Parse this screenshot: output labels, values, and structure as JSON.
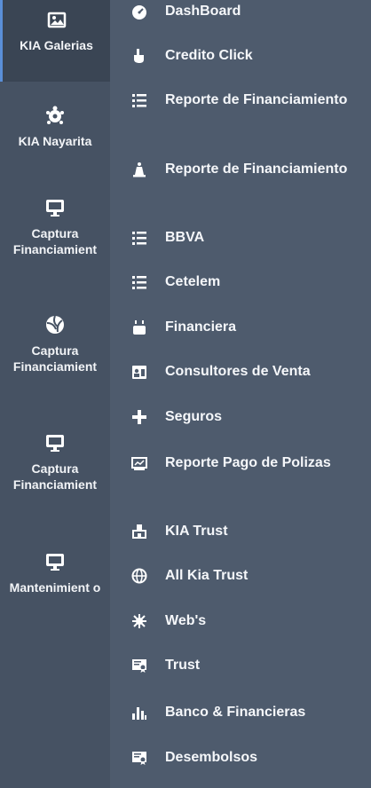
{
  "left_nav": [
    {
      "label": "KIA Galerias",
      "icon": "image-icon",
      "active": true
    },
    {
      "label": "KIA Nayarita",
      "icon": "turtle-icon",
      "active": false
    },
    {
      "label": "Captura Financiamient",
      "icon": "monitor-icon",
      "active": false
    },
    {
      "label": "Captura Financiamient",
      "icon": "volleyball-icon",
      "active": false
    },
    {
      "label": "Captura Financiamient",
      "icon": "monitor-icon",
      "active": false
    },
    {
      "label": "Mantenimient o",
      "icon": "monitor-icon",
      "active": false
    }
  ],
  "menu": [
    {
      "label": "DashBoard",
      "icon": "dashboard-icon"
    },
    {
      "label": "Credito Click",
      "icon": "pointer-icon"
    },
    {
      "label": "Reporte de Financiamiento",
      "icon": "list-icon"
    },
    {
      "label": "Reporte de Financiamiento",
      "icon": "chess-icon"
    },
    {
      "label": "BBVA",
      "icon": "list-icon"
    },
    {
      "label": "Cetelem",
      "icon": "list-icon"
    },
    {
      "label": "Financiera",
      "icon": "cake-icon"
    },
    {
      "label": "Consultores de Venta",
      "icon": "id-card-icon"
    },
    {
      "label": "Seguros",
      "icon": "plus-icon"
    },
    {
      "label": "Reporte Pago de Polizas",
      "icon": "chart-box-icon"
    },
    {
      "label": "KIA Trust",
      "icon": "building-icon"
    },
    {
      "label": "All Kia Trust",
      "icon": "globe-icon"
    },
    {
      "label": "Web's",
      "icon": "virus-icon"
    },
    {
      "label": "Trust",
      "icon": "certificate-icon"
    },
    {
      "label": "Banco & Financieras",
      "icon": "bar-chart-icon"
    },
    {
      "label": "Desembolsos",
      "icon": "certificate-icon"
    }
  ],
  "colors": {
    "left_bg": "#465263",
    "right_bg": "#4e5b6d",
    "active_bg": "#3a4554",
    "text": "#f5f7fa"
  }
}
